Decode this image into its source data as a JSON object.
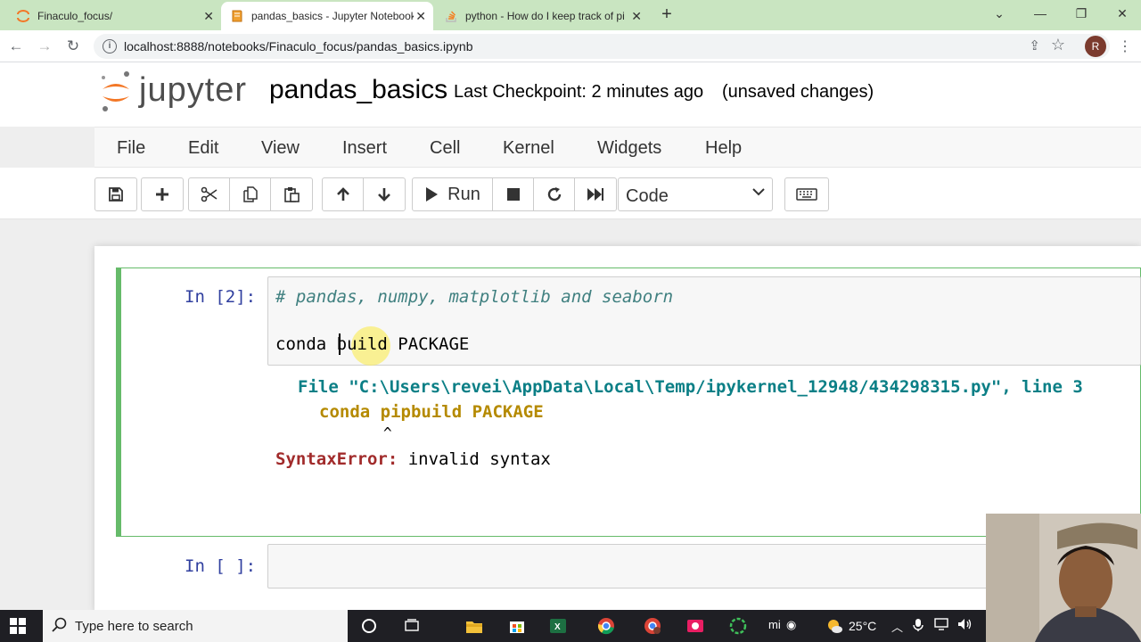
{
  "browser": {
    "tabs": [
      {
        "title": "Finaculo_focus/",
        "active": false,
        "icon": "jupyter-favicon"
      },
      {
        "title": "pandas_basics - Jupyter Notebook",
        "active": true,
        "icon": "notebook-favicon"
      },
      {
        "title": "python - How do I keep track of pip",
        "active": false,
        "icon": "stackoverflow-favicon"
      }
    ],
    "url": "localhost:8888/notebooks/Finaculo_focus/pandas_basics.ipynb",
    "profile_initial": "R"
  },
  "jupyter": {
    "logo_text": "jupyter",
    "notebook_name": "pandas_basics",
    "checkpoint": "Last Checkpoint: 2 minutes ago",
    "save_status": "(unsaved changes)",
    "menu": [
      "File",
      "Edit",
      "View",
      "Insert",
      "Cell",
      "Kernel",
      "Widgets",
      "Help"
    ],
    "toolbar": {
      "run_label": "Run",
      "cell_type": "Code"
    }
  },
  "cells": [
    {
      "prompt": "In [2]:",
      "source": {
        "comment": "# pandas, numpy, matplotlib and seaborn",
        "line2": "conda build PACKAGE"
      },
      "output": {
        "file_prefix": "File ",
        "file_path": "\"C:\\Users\\revei\\AppData\\Local\\Temp/ipykernel_12948/434298315.py\"",
        "line_sep": ", line ",
        "line_no": "3",
        "code_line": "conda pipbuild PACKAGE",
        "caret": "^",
        "error_type": "SyntaxError:",
        "error_msg": " invalid syntax"
      }
    },
    {
      "prompt": "In [ ]:"
    }
  ],
  "taskbar": {
    "search_placeholder": "Type here to search",
    "temperature": "25°C"
  }
}
